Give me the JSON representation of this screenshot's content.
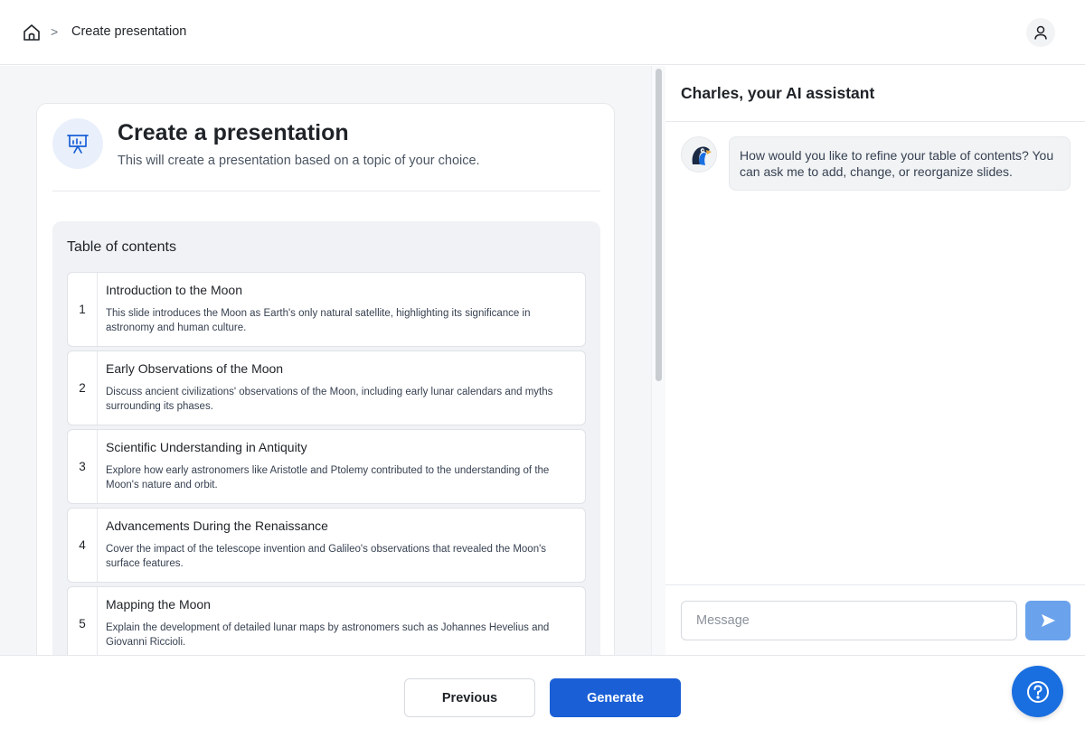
{
  "breadcrumb": {
    "home_icon": "home-icon",
    "separator": ">",
    "current": "Create presentation"
  },
  "header": {
    "user_icon": "user-icon"
  },
  "card": {
    "icon": "presentation-icon",
    "title": "Create a presentation",
    "subtitle": "This will create a presentation based on a topic of your choice."
  },
  "toc": {
    "title": "Table of contents",
    "items": [
      {
        "num": "1",
        "title": "Introduction to the Moon",
        "desc": "This slide introduces the Moon as Earth's only natural satellite, highlighting its significance in astronomy and human culture."
      },
      {
        "num": "2",
        "title": "Early Observations of the Moon",
        "desc": "Discuss ancient civilizations' observations of the Moon, including early lunar calendars and myths surrounding its phases."
      },
      {
        "num": "3",
        "title": "Scientific Understanding in Antiquity",
        "desc": "Explore how early astronomers like Aristotle and Ptolemy contributed to the understanding of the Moon's nature and orbit."
      },
      {
        "num": "4",
        "title": "Advancements During the Renaissance",
        "desc": "Cover the impact of the telescope invention and Galileo's observations that revealed the Moon's surface features."
      },
      {
        "num": "5",
        "title": "Mapping the Moon",
        "desc": "Explain the development of detailed lunar maps by astronomers such as Johannes Hevelius and Giovanni Riccioli."
      }
    ]
  },
  "assistant": {
    "title": "Charles, your AI assistant",
    "avatar_icon": "parrot-avatar-icon",
    "message": "How would you like to refine your table of contents? You can ask me to add, change, or reorganize slides.",
    "input_placeholder": "Message",
    "send_icon": "send-icon"
  },
  "footer": {
    "previous_label": "Previous",
    "generate_label": "Generate",
    "help_icon": "help-icon"
  },
  "colors": {
    "primary": "#1a5fd6",
    "send_button": "#6aa2ec",
    "help_button": "#1a6fe0",
    "panel_bg": "#f5f6f8"
  }
}
